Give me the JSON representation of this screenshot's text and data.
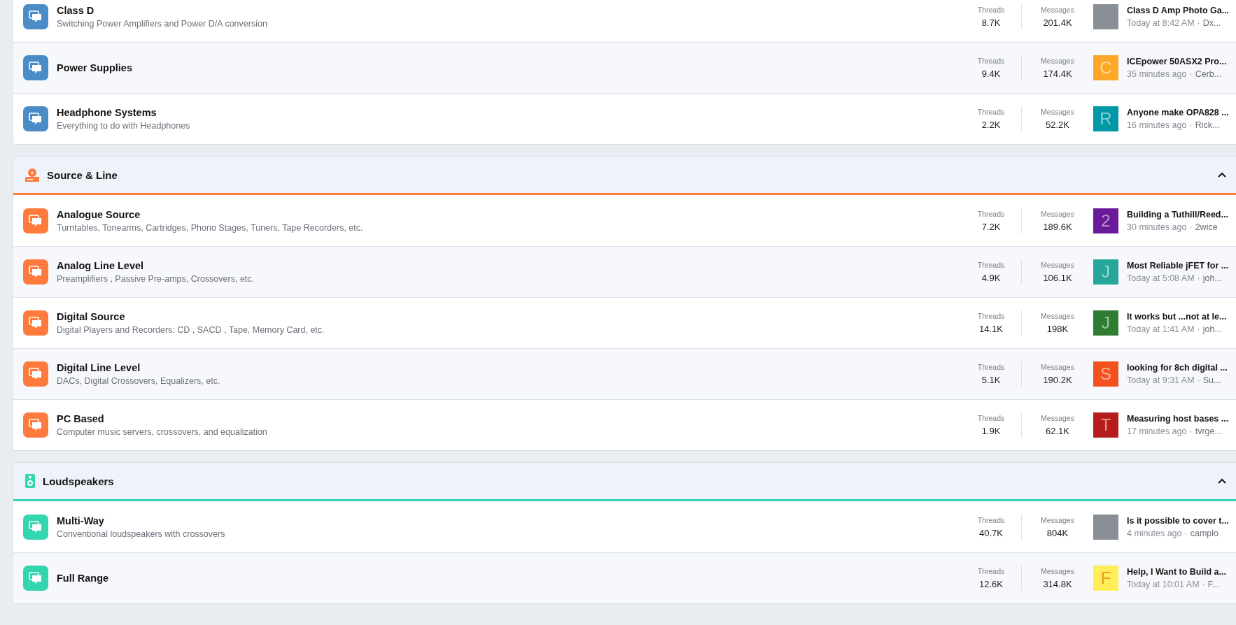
{
  "sections": [
    {
      "color": "#4a8cc8",
      "forums": [
        {
          "title": "Class D",
          "description": "Switching Power Amplifiers and Power D/A conversion",
          "threads_label": "Threads",
          "threads": "8.7K",
          "messages_label": "Messages",
          "messages": "201.4K",
          "latest_title": "Class D Amp Photo Ga...",
          "latest_time": "Today at 8:42 AM",
          "separator": "·",
          "latest_user": "Dx...",
          "avatar": {
            "kind": "photo"
          }
        },
        {
          "title": "Power Supplies",
          "threads_label": "Threads",
          "threads": "9.4K",
          "messages_label": "Messages",
          "messages": "174.4K",
          "latest_title": "ICEpower 50ASX2 Pro...",
          "latest_time": "35 minutes ago",
          "separator": "·",
          "latest_user": "Cerb...",
          "avatar": {
            "kind": "letter",
            "letter": "C",
            "color": "#ffa726"
          }
        },
        {
          "title": "Headphone Systems",
          "description": "Everything to do with Headphones",
          "threads_label": "Threads",
          "threads": "2.2K",
          "messages_label": "Messages",
          "messages": "52.2K",
          "latest_title": "Anyone make OPA828 ...",
          "latest_time": "16 minutes ago",
          "separator": "·",
          "latest_user": "Rick...",
          "avatar": {
            "kind": "letter",
            "letter": "R",
            "color": "#0097a7"
          }
        }
      ]
    },
    {
      "title": "Source & Line",
      "kind": "player",
      "color": "#ff7a3d",
      "forums": [
        {
          "title": "Analogue Source",
          "description": "Turntables, Tonearms, Cartridges, Phono Stages, Tuners, Tape Recorders, etc.",
          "threads_label": "Threads",
          "threads": "7.2K",
          "messages_label": "Messages",
          "messages": "189.6K",
          "latest_title": "Building a Tuthill/Reed...",
          "latest_time": "30 minutes ago",
          "separator": "·",
          "latest_user": "2wice",
          "avatar": {
            "kind": "letter",
            "letter": "2",
            "color": "#6a1b9a"
          }
        },
        {
          "title": "Analog Line Level",
          "description": "Preamplifiers , Passive Pre-amps, Crossovers, etc.",
          "threads_label": "Threads",
          "threads": "4.9K",
          "messages_label": "Messages",
          "messages": "106.1K",
          "latest_title": "Most Reliable jFET for ...",
          "latest_time": "Today at 5:08 AM",
          "separator": "·",
          "latest_user": "joh...",
          "avatar": {
            "kind": "letter",
            "letter": "J",
            "color": "#26a69a"
          }
        },
        {
          "title": "Digital Source",
          "description": "Digital Players and Recorders: CD , SACD , Tape, Memory Card, etc.",
          "threads_label": "Threads",
          "threads": "14.1K",
          "messages_label": "Messages",
          "messages": "198K",
          "latest_title": "It works but ...not at le...",
          "latest_time": "Today at 1:41 AM",
          "separator": "·",
          "latest_user": "joh...",
          "avatar": {
            "kind": "letter",
            "letter": "J",
            "color": "#2e7d32"
          }
        },
        {
          "title": "Digital Line Level",
          "description": "DACs, Digital Crossovers, Equalizers, etc.",
          "threads_label": "Threads",
          "threads": "5.1K",
          "messages_label": "Messages",
          "messages": "190.2K",
          "latest_title": "looking for 8ch digital ...",
          "latest_time": "Today at 9:31 AM",
          "separator": "·",
          "latest_user": "Su...",
          "avatar": {
            "kind": "letter",
            "letter": "S",
            "color": "#f4511e"
          }
        },
        {
          "title": "PC Based",
          "description": "Computer music servers, crossovers, and equalization",
          "threads_label": "Threads",
          "threads": "1.9K",
          "messages_label": "Messages",
          "messages": "62.1K",
          "latest_title": "Measuring host bases ...",
          "latest_time": "17 minutes ago",
          "separator": "·",
          "latest_user": "tvrge...",
          "avatar": {
            "kind": "letter",
            "letter": "T",
            "color": "#b71c1c"
          }
        }
      ]
    },
    {
      "title": "Loudspeakers",
      "kind": "speaker",
      "color": "#34d6b0",
      "forums": [
        {
          "title": "Multi-Way",
          "description": "Conventional loudspeakers with crossovers",
          "threads_label": "Threads",
          "threads": "40.7K",
          "messages_label": "Messages",
          "messages": "804K",
          "latest_title": "Is it possible to cover t...",
          "latest_time": "4 minutes ago",
          "separator": "·",
          "latest_user": "camplo",
          "avatar": {
            "kind": "photo"
          }
        },
        {
          "title": "Full Range",
          "threads_label": "Threads",
          "threads": "12.6K",
          "messages_label": "Messages",
          "messages": "314.8K",
          "latest_title": "Help, I Want to Build a...",
          "latest_time": "Today at 10:01 AM",
          "separator": "·",
          "latest_user": "F...",
          "avatar": {
            "kind": "letter",
            "letter": "F",
            "color": "#ffee58"
          }
        }
      ]
    }
  ]
}
